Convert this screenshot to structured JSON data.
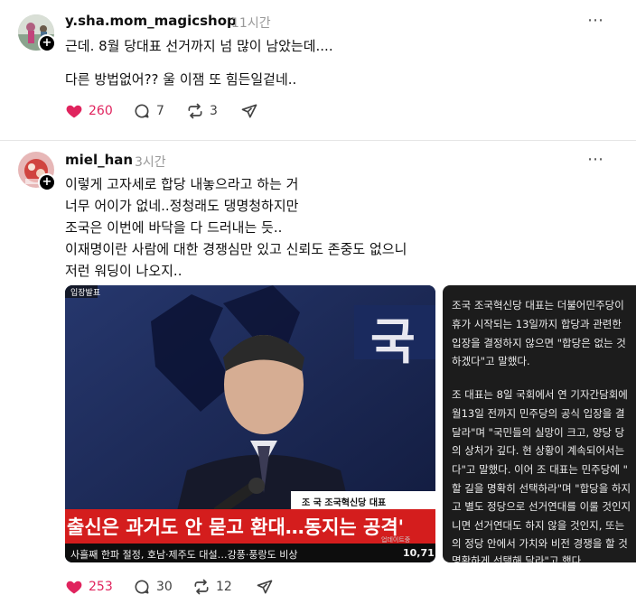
{
  "posts": [
    {
      "username": "y.sha.mom_magicshop",
      "time": "11시간",
      "lines": [
        "근데. 8월 당대표 선거까지 넘 많이 남았는데....",
        "다른 방법없어?? 울 이잼 또 힘든일겉네.."
      ],
      "likes": "260",
      "comments": "7",
      "reposts": "3"
    },
    {
      "username": "miel_han",
      "time": "3시간",
      "lines": [
        "이렇게 고자세로 합당 내놓으라고 하는 거",
        "너무 어이가 없네..정청래도 댕명청하지만",
        "조국은 이번에 바닥을 다 드러내는 듯..",
        "이재명이란 사람에 대한 경쟁심만 있고 신뢰도 존중도 없으니",
        "저런 워딩이 나오지.."
      ],
      "likes": "253",
      "comments": "30",
      "reposts": "12",
      "tv": {
        "corner_tag": "입장발표",
        "backdrop_text": "국",
        "name_caption": "조 국  조국혁신당 대표",
        "headline": "출신은 과거도 안 묻고 환대…동지는 공격'",
        "ticker": "사흘째 한파 절정, 호남·제주도 대설…강풍·풍랑도 비상",
        "ticker_right": "10,71",
        "small_tag": "업데이트중"
      },
      "news_lines": [
        "조국 조국혁신당 대표는 더불어민주당이",
        "휴가 시작되는 13일까지 합당과 관련한",
        "입장을 결정하지 않으면 \"합당은 없는 것",
        "하겠다\"고 말했다.",
        "",
        "조 대표는 8일 국회에서 연 기자간담회에",
        "월13일 전까지 민주당의 공식 입장을 결",
        "달라\"며 \"국민들의 실망이 크고, 양당 당",
        "의 상처가 깊다. 현 상황이 계속되어서는",
        "다\"고 말했다. 이어 조 대표는 민주당에 \"",
        "할 길을 명확히 선택하라\"며 \"합당을 하지",
        "고 별도 정당으로 선거연대를 이룰 것인지",
        "니면 선거연대도 하지 않을 것인지, 또는",
        "의 정당 안에서 가치와 비전 경쟁을 할 것",
        "명확하게 선택해 달라\"고 했다."
      ]
    }
  ]
}
